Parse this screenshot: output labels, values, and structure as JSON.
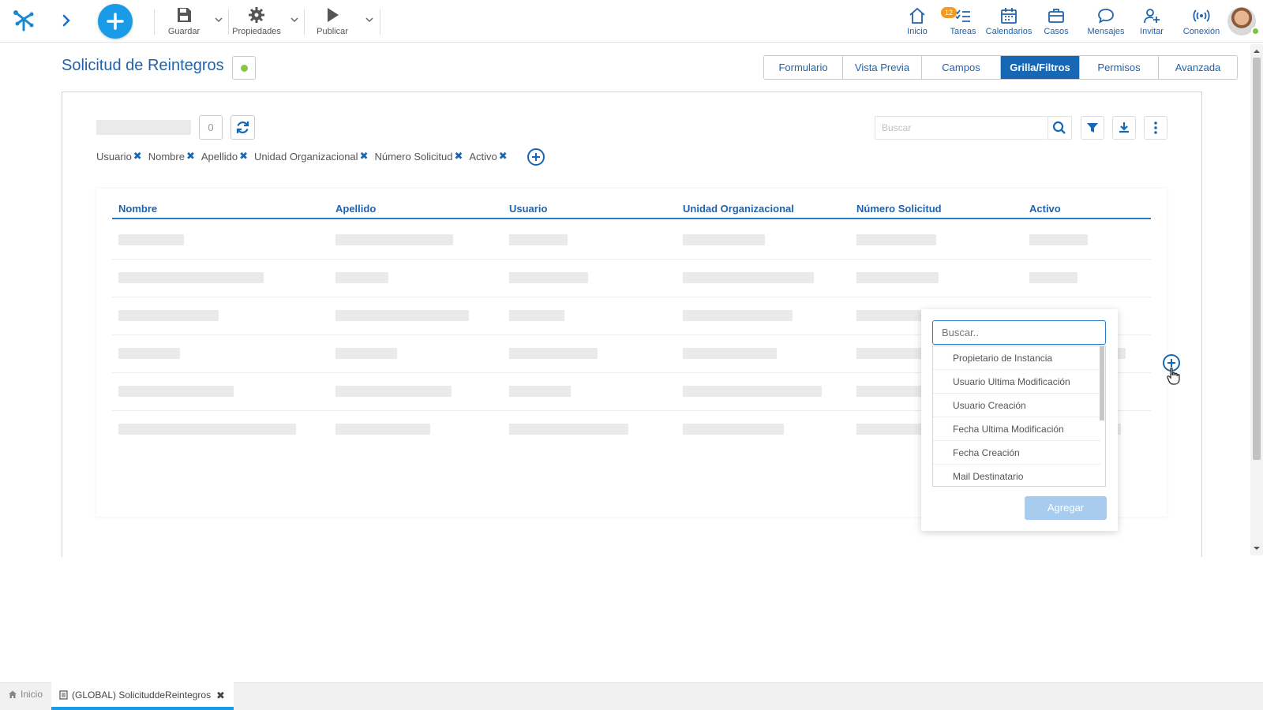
{
  "toolbar": {
    "save_label": "Guardar",
    "properties_label": "Propiedades",
    "publish_label": "Publicar"
  },
  "nav": {
    "inicio": "Inicio",
    "tareas": "Tareas",
    "tareas_badge": "12",
    "calendarios": "Calendarios",
    "casos": "Casos",
    "mensajes": "Mensajes",
    "invitar": "Invitar",
    "conexion": "Conexión"
  },
  "page": {
    "title": "Solicitud de Reintegros"
  },
  "tabs": [
    "Formulario",
    "Vista Previa",
    "Campos",
    "Grilla/Filtros",
    "Permisos",
    "Avanzada"
  ],
  "active_tab": "Grilla/Filtros",
  "grid": {
    "count": "0",
    "search_placeholder": "Buscar",
    "filter_chips": [
      "Usuario",
      "Nombre",
      "Apellido",
      "Unidad Organizacional",
      "Número Solicitud",
      "Activo"
    ],
    "columns": [
      "Nombre",
      "Apellido",
      "Usuario",
      "Unidad Organizacional",
      "Número Solicitud",
      "Activo"
    ]
  },
  "popover": {
    "search_placeholder": "Buscar..",
    "items": [
      "Propietario de Instancia",
      "Usuario Ultima Modificación",
      "Usuario Creación",
      "Fecha Ultima Modificación",
      "Fecha Creación",
      "Mail Destinatario"
    ],
    "add_label": "Agregar"
  },
  "taskbar": {
    "home_label": "Inicio",
    "tab_label": "(GLOBAL) SolicituddeReintegros"
  },
  "colors": {
    "brand": "#1a9be8",
    "accent": "#1667b4",
    "status_dot": "#8cc63f",
    "badge": "#f39a1d"
  }
}
